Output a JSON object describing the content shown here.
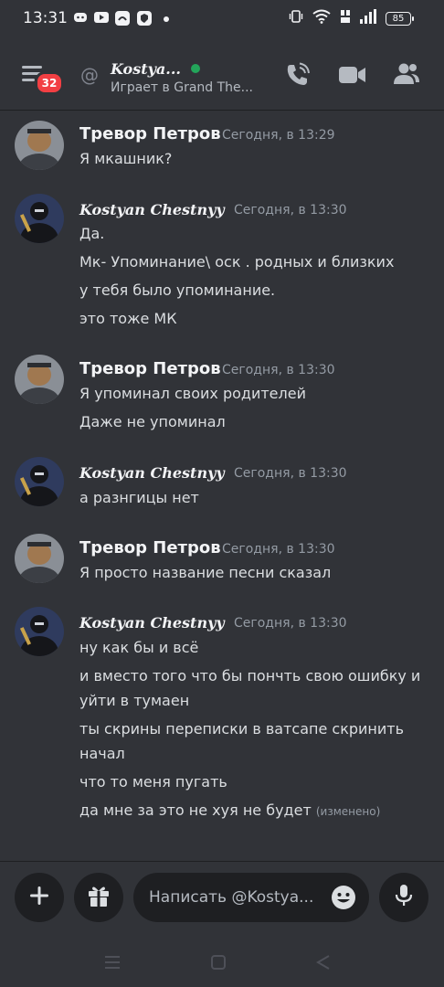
{
  "status_bar": {
    "time": "13:31",
    "battery": "85"
  },
  "header": {
    "unread_count": "32",
    "name": "Kostya...",
    "activity": "Играет в Grand The...",
    "colors": {
      "online": "#23a55a",
      "badge": "#f23f43"
    }
  },
  "messages": [
    {
      "author": "Тревор Петров",
      "time": "Сегодня, в 13:29",
      "lines": [
        "Я мкашник?"
      ]
    },
    {
      "author": "Kostyan Chestnyy",
      "time": "Сегодня, в 13:30",
      "lines": [
        "Да.",
        "Мк- Упоминание\\ оск . родных и близких",
        "у тебя было  упоминание.",
        "это тоже МК"
      ]
    },
    {
      "author": "Тревор Петров",
      "time": "Сегодня, в 13:30",
      "lines": [
        "Я упоминал своих родителей",
        "Даже не упоминал"
      ]
    },
    {
      "author": "Kostyan Chestnyy",
      "time": "Сегодня, в 13:30",
      "lines": [
        "а разнгицы нет"
      ]
    },
    {
      "author": "Тревор Петров",
      "time": "Сегодня, в 13:30",
      "lines": [
        "Я просто название песни сказал"
      ]
    },
    {
      "author": "Kostyan Chestnyy",
      "time": "Сегодня, в 13:30",
      "lines": [
        "ну как бы и всё",
        "и вместо того что бы пончть свою ошибку и",
        "уйти в тумаен",
        "ты скрины переписки в ватсапе скринить",
        "начал",
        "что то меня пугать",
        "да мне за это не хуя не будет"
      ],
      "edited": "(изменено)"
    }
  ],
  "composer": {
    "placeholder": "Написать @Kostya..."
  }
}
